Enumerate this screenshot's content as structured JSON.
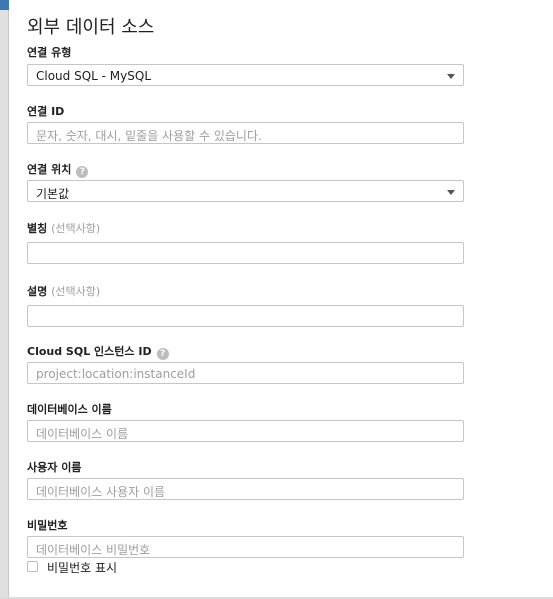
{
  "dialog": {
    "title": "외부 데이터 소스"
  },
  "connection_type": {
    "label": "연결 유형",
    "value": "Cloud SQL - MySQL"
  },
  "connection_id": {
    "label": "연결 ID",
    "placeholder": "문자, 숫자, 대시, 밑줄을 사용할 수 있습니다."
  },
  "connection_location": {
    "label": "연결 위치",
    "value": "기본값"
  },
  "alias": {
    "label": "별칭",
    "optional": "(선택사항)",
    "value": ""
  },
  "description": {
    "label": "설명",
    "optional": "(선택사항)",
    "value": ""
  },
  "instance_id": {
    "label": "Cloud SQL 인스턴스 ID",
    "placeholder": "project:location:instanceId"
  },
  "database_name": {
    "label": "데이터베이스 이름",
    "placeholder": "데이터베이스 이름"
  },
  "username": {
    "label": "사용자 이름",
    "placeholder": "데이터베이스 사용자 이름"
  },
  "password": {
    "label": "비밀번호",
    "placeholder": "데이터베이스 비밀번호",
    "show_label": "비밀번호 표시"
  },
  "colors": {
    "border": "#c6c6c6",
    "placeholder": "#9e9e9e",
    "optional_text": "#9e9e9e",
    "help_icon": "#bdbdbd"
  }
}
